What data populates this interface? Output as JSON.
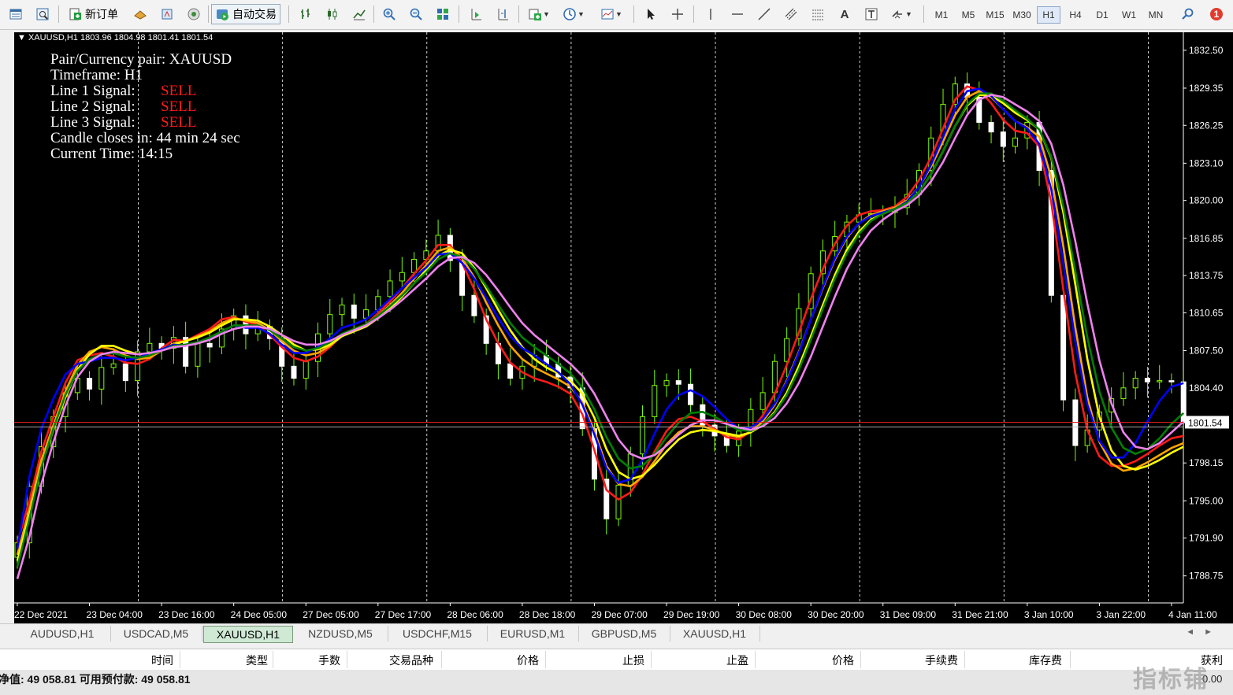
{
  "toolbar": {
    "new_order_label": "新订单",
    "auto_trading_label": "自动交易",
    "timeframes": [
      "M1",
      "M5",
      "M15",
      "M30",
      "H1",
      "H4",
      "D1",
      "W1",
      "MN"
    ],
    "active_timeframe": "H1",
    "notification_count": "1",
    "icons": [
      "market-watch-icon",
      "navigator-icon",
      "new-order-icon",
      "expert-icon",
      "history-icon",
      "signal-icon",
      "auto-trading-icon",
      "bar-chart-icon",
      "candle-chart-icon",
      "line-chart-icon",
      "zoom-in-icon",
      "zoom-out-icon",
      "tile-icon",
      "autoscroll-icon",
      "chart-shift-icon",
      "indicators-icon",
      "periods-icon",
      "templates-icon",
      "cursor-icon",
      "crosshair-icon",
      "vertical-line-icon",
      "horizontal-line-icon",
      "trend-line-icon",
      "equidistant-channel-icon",
      "fibonacci-icon",
      "text-icon",
      "text-label-icon",
      "arrows-icon",
      "search-icon",
      "notification-icon"
    ]
  },
  "chart": {
    "title": "XAUUSD,H1  1803.96 1804.98 1801.41 1801.54",
    "background": "#000000",
    "current_price": "1801.54"
  },
  "indicator": {
    "pair_label": "Pair/Currency pair: XAUUSD",
    "timeframe_label": "Timeframe: H1",
    "line1_label": "Line 1 Signal:",
    "line1_value": "SELL",
    "line2_label": "Line 2 Signal:",
    "line2_value": "SELL",
    "line3_label": "Line 3 Signal:",
    "line3_value": "SELL",
    "candle_label": "Candle closes in: 44 min 24 sec",
    "time_label": "Current Time: 14:15"
  },
  "chart_data": {
    "type": "line",
    "symbol": "XAUUSD",
    "timeframe": "H1",
    "ylim": [
      1786.5,
      1834
    ],
    "y_ticks": [
      "1832.50",
      "1829.35",
      "1826.25",
      "1823.10",
      "1820.00",
      "1816.85",
      "1813.75",
      "1810.65",
      "1807.50",
      "1804.40",
      "1801.54",
      "1798.15",
      "1795.00",
      "1791.90",
      "1788.75"
    ],
    "x_ticks": [
      "22 Dec 2021",
      "23 Dec 04:00",
      "23 Dec 16:00",
      "24 Dec 05:00",
      "27 Dec 05:00",
      "27 Dec 17:00",
      "28 Dec 06:00",
      "28 Dec 18:00",
      "29 Dec 07:00",
      "29 Dec 19:00",
      "30 Dec 08:00",
      "30 Dec 20:00",
      "31 Dec 09:00",
      "31 Dec 21:00",
      "3 Jan 10:00",
      "3 Jan 22:00",
      "4 Jan 11:00"
    ],
    "x_tick_index": [
      0,
      6,
      12,
      18,
      24,
      30,
      36,
      42,
      48,
      54,
      60,
      66,
      72,
      78,
      84,
      90,
      96
    ],
    "n_bars": 98,
    "close": [
      1791.5,
      1796.2,
      1799.5,
      1802.0,
      1804.0,
      1805.2,
      1804.3,
      1806.1,
      1806.4,
      1805.0,
      1807.4,
      1808.1,
      1807.7,
      1808.6,
      1806.2,
      1808.1,
      1807.8,
      1809.3,
      1810.4,
      1808.9,
      1809.5,
      1808.5,
      1806.2,
      1805.2,
      1806.6,
      1808.9,
      1810.5,
      1811.3,
      1810.2,
      1810.9,
      1812.0,
      1813.3,
      1814.0,
      1815.1,
      1815.8,
      1817.1,
      1815.0,
      1812.1,
      1810.4,
      1808.1,
      1806.4,
      1805.2,
      1806.2,
      1807.1,
      1806.4,
      1805.3,
      1804.4,
      1801.0,
      1796.8,
      1793.5,
      1796.3,
      1798.9,
      1802.0,
      1804.6,
      1805.0,
      1804.7,
      1803.0,
      1801.3,
      1800.4,
      1799.6,
      1800.8,
      1802.6,
      1804.0,
      1806.6,
      1808.5,
      1811.0,
      1813.9,
      1815.8,
      1817.0,
      1818.2,
      1818.8,
      1818.9,
      1819.0,
      1819.4,
      1820.5,
      1822.5,
      1825.2,
      1828.0,
      1829.7,
      1828.6,
      1826.5,
      1825.7,
      1824.5,
      1825.2,
      1826.5,
      1822.5,
      1812.1,
      1803.4,
      1799.6,
      1800.9,
      1802.4,
      1803.5,
      1804.4,
      1805.2,
      1804.9,
      1805.0,
      1804.9,
      1801.5
    ],
    "series": [
      {
        "name": "Line 1",
        "color": "#ff1a1a",
        "values": [
          1791.5,
          1795.0,
          1799.1,
          1802.0,
          1804.8,
          1806.7,
          1807.1,
          1807.3,
          1807.0,
          1806.5,
          1806.4,
          1806.8,
          1807.7,
          1808.4,
          1808.3,
          1808.8,
          1809.3,
          1810.1,
          1810.3,
          1809.9,
          1809.6,
          1808.8,
          1807.8,
          1806.9,
          1806.6,
          1807.0,
          1807.8,
          1808.8,
          1809.3,
          1809.7,
          1810.6,
          1811.6,
          1812.7,
          1813.9,
          1815.0,
          1816.3,
          1816.3,
          1814.8,
          1812.6,
          1810.1,
          1808.1,
          1806.5,
          1805.7,
          1805.2,
          1804.9,
          1804.5,
          1803.9,
          1802.2,
          1799.2,
          1795.9,
          1795.1,
          1795.7,
          1797.2,
          1799.1,
          1800.8,
          1801.8,
          1802.0,
          1801.6,
          1801.0,
          1800.3,
          1800.1,
          1800.8,
          1802.1,
          1803.9,
          1806.3,
          1809.0,
          1811.8,
          1814.3,
          1816.4,
          1817.9,
          1818.8,
          1819.1,
          1819.2,
          1819.5,
          1820.3,
          1821.7,
          1823.6,
          1826.0,
          1828.4,
          1829.5,
          1829.2,
          1828.1,
          1826.7,
          1825.8,
          1825.6,
          1824.5,
          1819.8,
          1812.6,
          1805.6,
          1800.9,
          1798.7,
          1797.9,
          1797.9,
          1798.3,
          1798.9,
          1799.6,
          1800.2,
          1800.4
        ]
      },
      {
        "name": "Line 2",
        "color": "#ffa500",
        "values": [
          1790.5,
          1794.3,
          1798.4,
          1801.3,
          1804.1,
          1806.3,
          1807.4,
          1807.8,
          1807.6,
          1807.1,
          1806.8,
          1806.9,
          1807.5,
          1808.1,
          1808.3,
          1808.7,
          1809.1,
          1809.8,
          1810.2,
          1810.0,
          1809.8,
          1809.2,
          1808.3,
          1807.5,
          1807.1,
          1807.3,
          1807.9,
          1808.7,
          1809.2,
          1809.6,
          1810.4,
          1811.3,
          1812.3,
          1813.5,
          1814.6,
          1815.8,
          1816.1,
          1815.2,
          1813.6,
          1811.5,
          1809.6,
          1807.9,
          1806.8,
          1806.1,
          1805.6,
          1805.1,
          1804.5,
          1803.2,
          1800.8,
          1797.9,
          1796.4,
          1796.2,
          1797.0,
          1798.3,
          1799.7,
          1800.7,
          1801.2,
          1801.2,
          1800.9,
          1800.5,
          1800.3,
          1800.7,
          1801.6,
          1803.0,
          1805.0,
          1807.4,
          1810.1,
          1812.7,
          1815.1,
          1816.9,
          1818.1,
          1818.8,
          1819.1,
          1819.4,
          1820.0,
          1821.1,
          1822.8,
          1824.9,
          1827.1,
          1828.6,
          1829.1,
          1828.6,
          1827.6,
          1826.6,
          1826.1,
          1825.3,
          1821.9,
          1816.2,
          1809.4,
          1803.6,
          1799.9,
          1798.1,
          1797.5,
          1797.7,
          1798.2,
          1798.8,
          1799.4,
          1799.8
        ]
      },
      {
        "name": "Line 3",
        "color": "#ffff00",
        "values": [
          1790.0,
          1793.8,
          1797.9,
          1800.9,
          1803.6,
          1805.9,
          1807.2,
          1807.9,
          1807.9,
          1807.5,
          1807.2,
          1807.2,
          1807.6,
          1808.0,
          1808.3,
          1808.6,
          1809.0,
          1809.6,
          1810.1,
          1810.1,
          1810.0,
          1809.5,
          1808.8,
          1808.0,
          1807.5,
          1807.6,
          1808.0,
          1808.7,
          1809.1,
          1809.5,
          1810.2,
          1811.0,
          1812.0,
          1813.1,
          1814.2,
          1815.4,
          1815.9,
          1815.6,
          1814.4,
          1812.7,
          1810.9,
          1809.2,
          1807.8,
          1806.8,
          1806.1,
          1805.6,
          1805.0,
          1803.9,
          1801.9,
          1799.3,
          1797.4,
          1796.8,
          1797.1,
          1798.0,
          1799.1,
          1800.1,
          1800.7,
          1800.9,
          1800.8,
          1800.6,
          1800.4,
          1800.7,
          1801.3,
          1802.4,
          1804.0,
          1806.2,
          1808.7,
          1811.3,
          1813.8,
          1815.9,
          1817.4,
          1818.4,
          1818.9,
          1819.3,
          1819.8,
          1820.7,
          1822.2,
          1824.1,
          1826.2,
          1827.9,
          1828.8,
          1828.7,
          1828.1,
          1827.3,
          1826.7,
          1825.9,
          1823.5,
          1819.0,
          1813.0,
          1806.8,
          1802.0,
          1799.2,
          1797.9,
          1797.6,
          1797.9,
          1798.4,
          1799.0,
          1799.5
        ]
      },
      {
        "name": "Line 4",
        "color": "#0000ff",
        "values": [
          1791.0,
          1797.0,
          1801.0,
          1803.5,
          1805.5,
          1806.4,
          1806.6,
          1806.9,
          1806.9,
          1806.7,
          1806.9,
          1807.3,
          1807.6,
          1808.0,
          1807.9,
          1808.2,
          1808.5,
          1809.1,
          1809.6,
          1809.4,
          1809.4,
          1808.9,
          1808.0,
          1807.3,
          1807.3,
          1807.8,
          1808.5,
          1809.4,
          1809.7,
          1810.1,
          1810.9,
          1811.8,
          1812.7,
          1813.6,
          1814.4,
          1815.5,
          1815.6,
          1814.8,
          1813.5,
          1811.9,
          1810.2,
          1808.7,
          1807.7,
          1807.1,
          1806.4,
          1805.7,
          1804.7,
          1803.0,
          1800.5,
          1797.7,
          1796.5,
          1796.8,
          1798.4,
          1800.6,
          1802.6,
          1803.8,
          1804.2,
          1803.7,
          1802.8,
          1801.8,
          1801.0,
          1801.1,
          1801.8,
          1803.1,
          1804.9,
          1807.3,
          1810.1,
          1812.8,
          1815.2,
          1817.0,
          1818.1,
          1818.7,
          1819.0,
          1819.3,
          1819.9,
          1821.1,
          1823.0,
          1825.3,
          1827.6,
          1829.1,
          1829.3,
          1828.7,
          1827.6,
          1826.6,
          1826.0,
          1824.7,
          1820.9,
          1814.8,
          1808.2,
          1803.0,
          1800.0,
          1798.6,
          1798.6,
          1799.8,
          1801.6,
          1803.3,
          1804.5,
          1804.8
        ]
      },
      {
        "name": "Line 5",
        "color": "#008000",
        "values": [
          1789.5,
          1793.5,
          1797.8,
          1801.0,
          1803.8,
          1805.8,
          1806.8,
          1807.2,
          1807.3,
          1807.0,
          1806.9,
          1807.1,
          1807.5,
          1807.9,
          1808.0,
          1808.2,
          1808.6,
          1809.1,
          1809.6,
          1809.6,
          1809.6,
          1809.2,
          1808.5,
          1807.8,
          1807.5,
          1807.7,
          1808.2,
          1808.9,
          1809.3,
          1809.7,
          1810.4,
          1811.2,
          1812.1,
          1813.1,
          1814.0,
          1815.1,
          1815.6,
          1815.3,
          1814.3,
          1812.9,
          1811.3,
          1809.8,
          1808.6,
          1807.8,
          1807.1,
          1806.4,
          1805.6,
          1804.4,
          1802.6,
          1800.3,
          1798.5,
          1797.7,
          1797.9,
          1798.9,
          1800.3,
          1801.5,
          1802.3,
          1802.4,
          1802.0,
          1801.4,
          1800.9,
          1800.8,
          1801.3,
          1802.3,
          1803.8,
          1805.9,
          1808.4,
          1811.0,
          1813.5,
          1815.6,
          1817.2,
          1818.3,
          1818.9,
          1819.3,
          1819.8,
          1820.7,
          1822.2,
          1824.1,
          1826.2,
          1828.0,
          1828.9,
          1828.9,
          1828.3,
          1827.5,
          1826.8,
          1825.9,
          1823.6,
          1819.5,
          1814.1,
          1808.6,
          1804.1,
          1801.1,
          1799.4,
          1798.9,
          1799.3,
          1800.2,
          1801.4,
          1802.3
        ]
      },
      {
        "name": "Line 6",
        "color": "#ee82ee",
        "values": [
          1788.5,
          1792.0,
          1796.4,
          1799.9,
          1802.9,
          1805.3,
          1806.6,
          1807.2,
          1807.4,
          1807.3,
          1807.2,
          1807.3,
          1807.5,
          1807.8,
          1807.9,
          1808.1,
          1808.4,
          1808.9,
          1809.3,
          1809.5,
          1809.5,
          1809.3,
          1808.8,
          1808.3,
          1808.0,
          1808.0,
          1808.3,
          1808.8,
          1809.2,
          1809.6,
          1810.2,
          1810.9,
          1811.7,
          1812.6,
          1813.5,
          1814.5,
          1815.2,
          1815.3,
          1814.8,
          1813.8,
          1812.5,
          1811.1,
          1809.8,
          1808.8,
          1808.0,
          1807.2,
          1806.4,
          1805.4,
          1803.9,
          1802.0,
          1800.1,
          1798.9,
          1798.5,
          1798.8,
          1799.6,
          1800.5,
          1801.3,
          1801.7,
          1801.7,
          1801.4,
          1801.1,
          1800.9,
          1801.2,
          1801.9,
          1803.1,
          1804.8,
          1807.0,
          1809.5,
          1812.0,
          1814.3,
          1816.1,
          1817.5,
          1818.4,
          1819.1,
          1819.6,
          1820.4,
          1821.6,
          1823.2,
          1825.2,
          1827.1,
          1828.4,
          1828.8,
          1828.6,
          1828.0,
          1827.4,
          1826.6,
          1824.7,
          1821.3,
          1816.6,
          1811.4,
          1806.7,
          1803.1,
          1800.7,
          1799.5,
          1799.3,
          1799.8,
          1800.7,
          1801.6
        ]
      }
    ]
  },
  "tabs": [
    {
      "label": "AUDUSD,H1",
      "active": false
    },
    {
      "label": "USDCAD,M5",
      "active": false
    },
    {
      "label": "XAUUSD,H1",
      "active": true
    },
    {
      "label": "NZDUSD,M5",
      "active": false
    },
    {
      "label": "USDCHF,M15",
      "active": false
    },
    {
      "label": "EURUSD,M1",
      "active": false
    },
    {
      "label": "GBPUSD,M5",
      "active": false
    },
    {
      "label": "XAUUSD,H1",
      "active": false
    }
  ],
  "trade_columns": [
    "时间",
    "类型",
    "手数",
    "交易品种",
    "价格",
    "止损",
    "止盈",
    "价格",
    "手续费",
    "库存费",
    "获利"
  ],
  "status": {
    "text": "净值: 49 058.81  可用预付款: 49 058.81",
    "badge": "0.00"
  },
  "watermark": "指标铺"
}
